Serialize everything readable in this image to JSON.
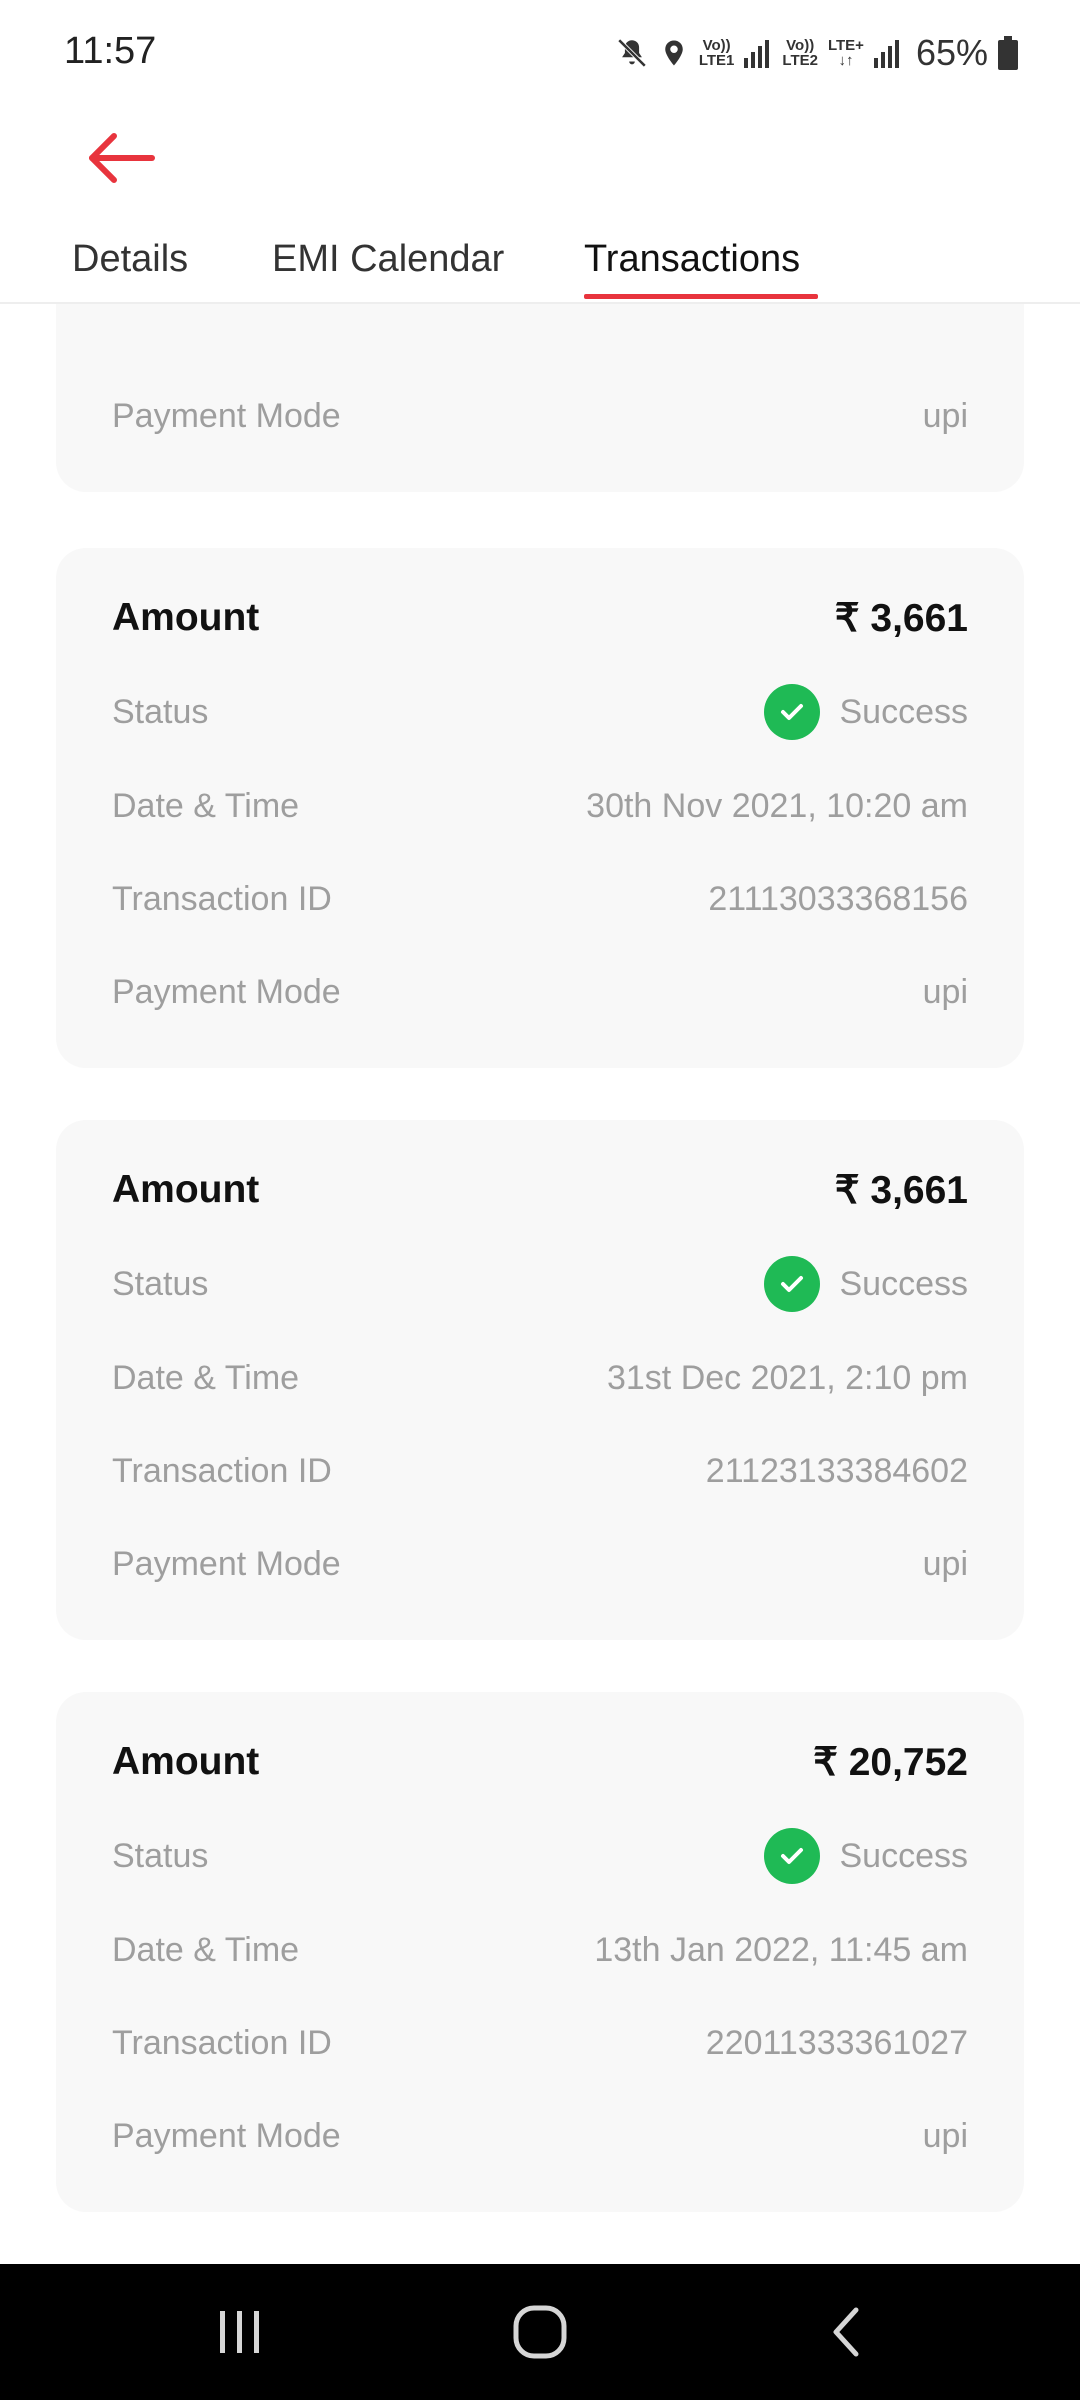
{
  "status_bar": {
    "time": "11:57",
    "battery": "65%",
    "net1_top": "Vo))",
    "net1_bottom": "LTE1",
    "net2_top": "Vo))",
    "net2_bottom": "LTE2",
    "net2_extra": "LTE+"
  },
  "header": {
    "back_icon": "arrow-left-icon",
    "accent_color": "#e8343d"
  },
  "tabs": [
    {
      "label": "Details",
      "active": false
    },
    {
      "label": "EMI Calendar",
      "active": false
    },
    {
      "label": "Transactions",
      "active": true
    }
  ],
  "partial_card": {
    "payment_mode_label": "Payment Mode",
    "payment_mode": "upi"
  },
  "transactions": [
    {
      "amount_label": "Amount",
      "amount": "₹ 3,661",
      "status_label": "Status",
      "status": "Success",
      "datetime_label": "Date & Time",
      "datetime": "30th Nov 2021, 10:20 am",
      "txn_label": "Transaction ID",
      "txn_id": "21113033368156",
      "mode_label": "Payment Mode",
      "mode": "upi"
    },
    {
      "amount_label": "Amount",
      "amount": "₹ 3,661",
      "status_label": "Status",
      "status": "Success",
      "datetime_label": "Date & Time",
      "datetime": "31st Dec 2021, 2:10 pm",
      "txn_label": "Transaction ID",
      "txn_id": "21123133384602",
      "mode_label": "Payment Mode",
      "mode": "upi"
    },
    {
      "amount_label": "Amount",
      "amount": "₹ 20,752",
      "status_label": "Status",
      "status": "Success",
      "datetime_label": "Date & Time",
      "datetime": "13th Jan 2022, 11:45 am",
      "txn_label": "Transaction ID",
      "txn_id": "22011333361027",
      "mode_label": "Payment Mode",
      "mode": "upi"
    }
  ],
  "colors": {
    "success": "#1fba55",
    "card_bg": "#f8f8f8",
    "muted_text": "#9e9e9e"
  }
}
